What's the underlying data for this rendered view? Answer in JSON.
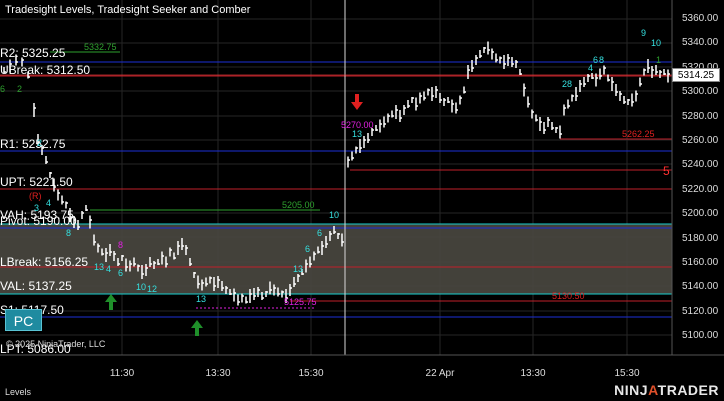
{
  "window": {
    "title": "Tradesight Levels, Tradesight Seeker and Comber",
    "panel_label": "Levels",
    "copyright": "© 2025 NinjaTrader, LLC",
    "logo_left": "NINJ",
    "logo_mid": "A",
    "logo_right": "TRADER",
    "pc_button_label": "PC"
  },
  "price_axis": {
    "ticks": [
      "5360.00",
      "5340.00",
      "5320.00",
      "5300.00",
      "5280.00",
      "5260.00",
      "5240.00",
      "5220.00",
      "5200.00",
      "5180.00",
      "5160.00",
      "5140.00",
      "5120.00",
      "5100.00"
    ],
    "current_price": "5314.25"
  },
  "time_axis": {
    "ticks": [
      "11:30",
      "13:30",
      "15:30",
      "22 Apr",
      "13:30",
      "15:30"
    ]
  },
  "level_labels": {
    "r2": "R2: 5325.25",
    "ubreak": "UBreak: 5312.50",
    "r1": "R1: 5252.75",
    "upt": "UPT: 5221.50",
    "vah": "VAH: 5193.75",
    "pivot": "Pivot: 5190.00",
    "lbreak": "LBreak: 5156.25",
    "val": "VAL: 5137.25",
    "s1": "S1: 5117.50",
    "lpt": "LPT: 5086.00"
  },
  "annotations": {
    "a5332": "5332.75",
    "a5270": "5270.00",
    "a5262": "5262.25",
    "a5205": "5205.00",
    "a5130": "5130.50",
    "a5125": "5125.75",
    "a5": "5",
    "r_marker": "(R)"
  },
  "colors": {
    "background": "#000000",
    "grid": "#2a2a2a",
    "r_level": "#1c2fd6",
    "s_level": "#1c2fd6",
    "break_level": "#c0202a",
    "value_area_fill": "#4a4840",
    "value_area_border": "#18d0d0",
    "upt_level": "#c0202a",
    "bar_color": "#ffffff",
    "seeker_count": "#35e0e0",
    "comber_count": "#2ea02e",
    "buy_arrow": "#1f8f2a",
    "sell_arrow": "#e02020",
    "magenta_label": "#e020e0",
    "current_price_line": "#ffffff"
  }
}
